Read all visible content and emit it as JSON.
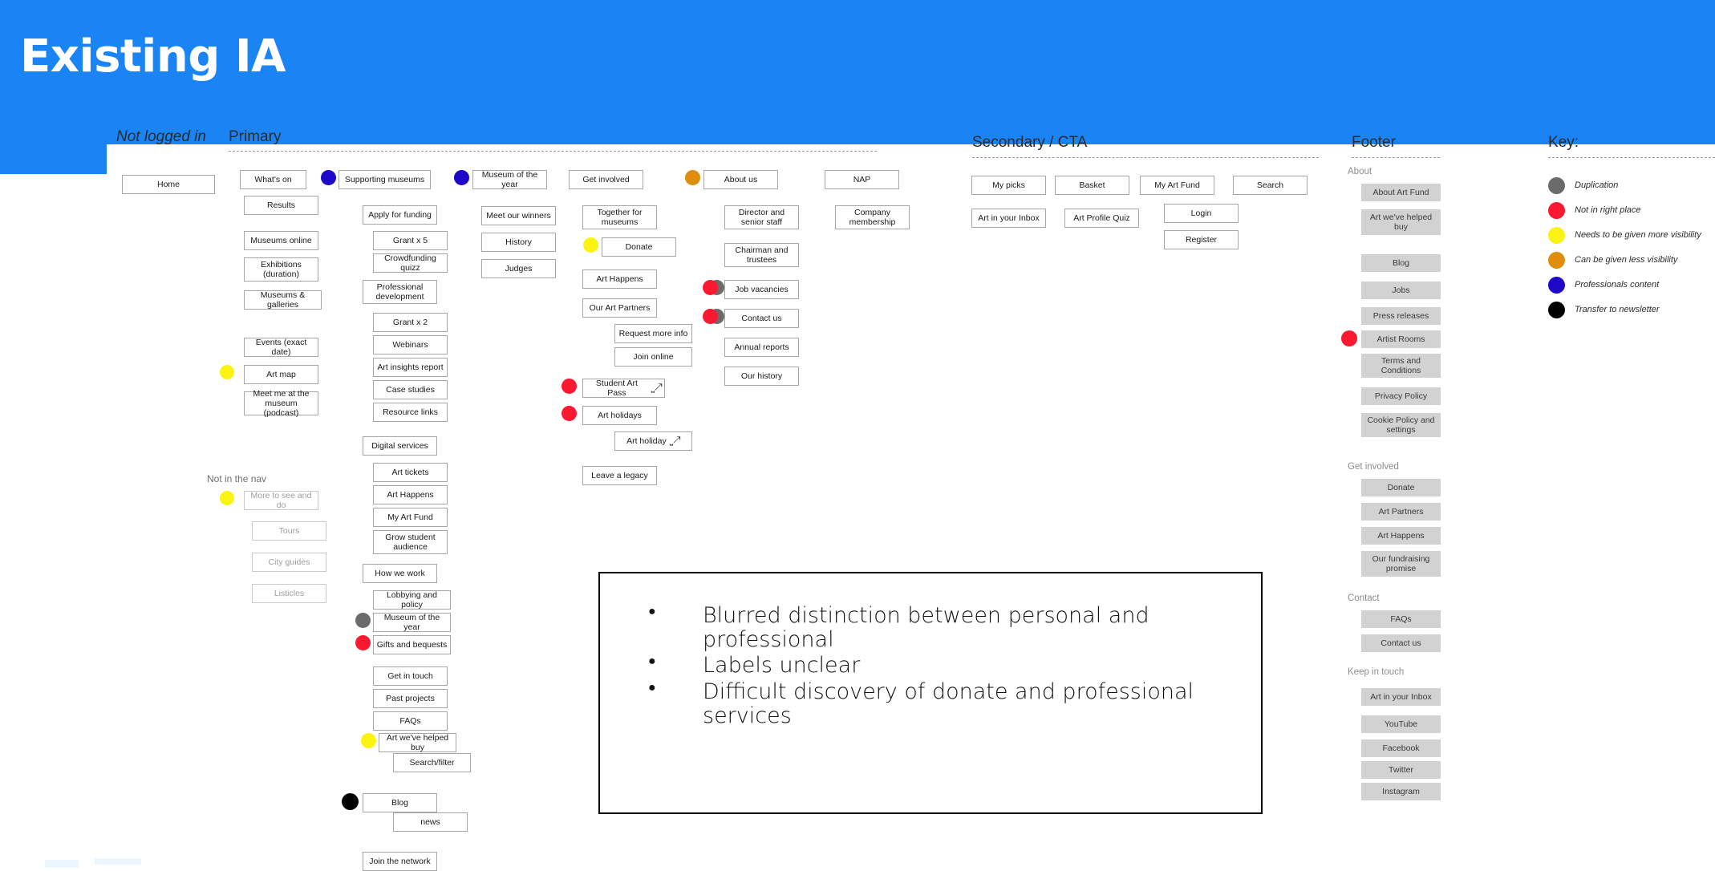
{
  "slide": {
    "title": "Existing IA"
  },
  "sections": {
    "not_logged_in": "Not logged in",
    "primary": "Primary",
    "secondary_cta": "Secondary / CTA",
    "footer": "Footer",
    "key": "Key:",
    "not_in_the_nav": "Not in the nav"
  },
  "home": {
    "label": "Home"
  },
  "primary": {
    "whats_on": "What's on",
    "children": [
      "Results",
      "Museums online",
      "Exhibitions (duration)",
      "Museums & galleries",
      "Events (exact date)",
      "Art map",
      "Meet me at the museum (podcast)"
    ],
    "not_in_nav": [
      "More to see and do",
      "Tours",
      "City guides",
      "Listicles"
    ]
  },
  "supporting_museums": {
    "title": "Supporting museums",
    "items": [
      "Apply for funding",
      "Grant x 5",
      "Crowdfunding quizz",
      "Professional development",
      "Grant x 2",
      "Webinars",
      "Art insights report",
      "Case studies",
      "Resource links",
      "Digital services",
      "Art tickets",
      "Art Happens",
      "My Art Fund",
      "Grow student audience",
      "How we work",
      "Lobbying and policy",
      "Museum of the year",
      "Gifts and bequests",
      "Get in touch",
      "Past projects",
      "FAQs",
      "Art we've helped buy",
      "Search/filter",
      "Blog",
      "news",
      "Join the network"
    ]
  },
  "museum_of_the_year": {
    "title": "Museum of the year",
    "items": [
      "Meet our winners",
      "History",
      "Judges"
    ]
  },
  "get_involved": {
    "title": "Get involved",
    "items": [
      "Together for museums",
      "Donate",
      "Art Happens",
      "Our Art Partners",
      "Request more info",
      "Join online",
      "Student Art Pass",
      "Art holidays",
      "Art holiday",
      "Leave a legacy"
    ]
  },
  "about_us": {
    "title": "About us",
    "items": [
      "Director and senior staff",
      "Chairman and trustees",
      "Job vacancies",
      "Contact us",
      "Annual reports",
      "Our history"
    ]
  },
  "nap": {
    "title": "NAP",
    "items": [
      "Company membership"
    ]
  },
  "secondary": {
    "row1": [
      "My picks",
      "Basket",
      "My Art Fund",
      "Search"
    ],
    "row2": [
      "Art in your Inbox",
      "Art Profile Quiz"
    ],
    "login": "Login",
    "register": "Register"
  },
  "footer": {
    "groups": [
      {
        "label": "About",
        "items": [
          "About Art Fund",
          "Art we've helped buy",
          "Blog",
          "Jobs",
          "Press releases",
          "Artist Rooms",
          "Terms and Conditions",
          "Privacy Policy",
          "Cookie Policy and settings"
        ]
      },
      {
        "label": "Get involved",
        "items": [
          "Donate",
          "Art Partners",
          "Art Happens",
          "Our fundraising promise"
        ]
      },
      {
        "label": "Contact",
        "items": [
          "FAQs",
          "Contact us"
        ]
      },
      {
        "label": "Keep in touch",
        "items": [
          "Art in your Inbox",
          "YouTube",
          "Facebook",
          "Twitter",
          "Instagram"
        ]
      }
    ]
  },
  "key": {
    "items": [
      {
        "color": "#6b6b6b",
        "label": "Duplication",
        "icon": "grey-dot-icon"
      },
      {
        "color": "#fb1831",
        "label": "Not in right place",
        "icon": "red-dot-icon"
      },
      {
        "color": "#fbf413",
        "label": "Needs to be given more visibility",
        "icon": "yellow-dot-icon"
      },
      {
        "color": "#de8d0c",
        "label": "Can be given less visibility",
        "icon": "orange-dot-icon"
      },
      {
        "color": "#1d08c7",
        "label": "Professionals content",
        "icon": "blue-dot-icon"
      },
      {
        "color": "#000000",
        "label": "Transfer to newsletter",
        "icon": "black-dot-icon"
      }
    ]
  },
  "callout": {
    "bullets": [
      "Blurred distinction between personal and professional",
      "Labels unclear",
      "Difficult discovery of donate and professional services"
    ]
  }
}
